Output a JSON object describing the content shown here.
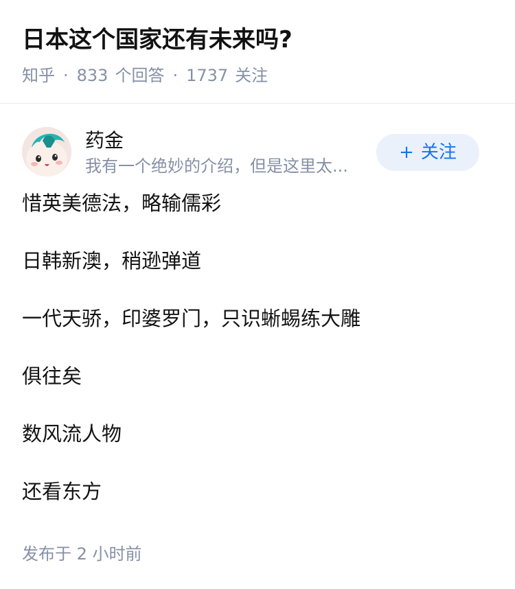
{
  "question": {
    "title": "日本这个国家还有未来吗?",
    "source": "知乎",
    "separator": "·",
    "answer_count": "833",
    "answer_label": "个回答",
    "follower_count": "1737",
    "follower_label": "关注"
  },
  "author": {
    "name": "药金",
    "bio": "我有一个绝妙的介绍，但是这里太...",
    "avatar_icon": "avatar-icon"
  },
  "follow_button": {
    "plus": "+",
    "label": "关注"
  },
  "answer": {
    "lines": [
      "惜英美德法，略输儒彩",
      "日韩新澳，稍逊弹道",
      "一代天骄，印婆罗门，只识蜥蜴练大雕",
      "俱往矣",
      "数风流人物",
      "还看东方"
    ],
    "publish_label": "发布于",
    "publish_time": "2 小时前"
  },
  "colors": {
    "title": "#121212",
    "meta": "#8590a6",
    "accent": "#1772f6",
    "button_bg": "#eaf1fb"
  }
}
